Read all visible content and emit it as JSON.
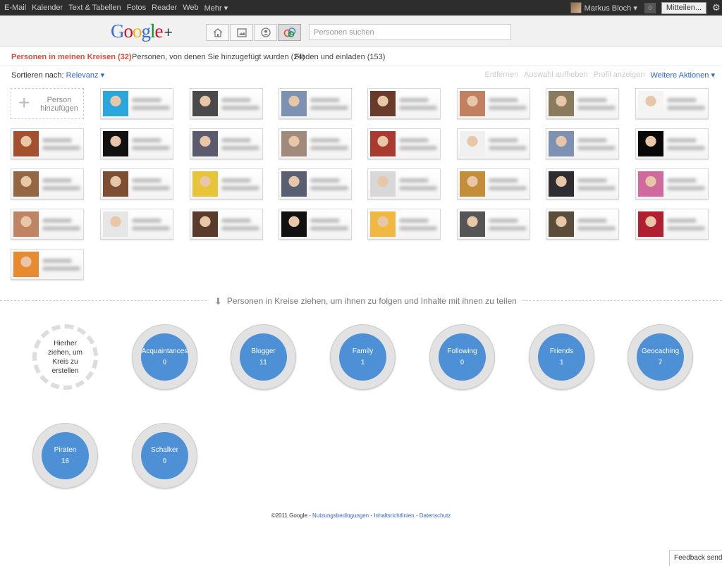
{
  "topbar": {
    "nav": [
      {
        "label": "E-Mail",
        "name": "nav-email"
      },
      {
        "label": "Kalender",
        "name": "nav-calendar"
      },
      {
        "label": "Text & Tabellen",
        "name": "nav-docs"
      },
      {
        "label": "Fotos",
        "name": "nav-photos"
      },
      {
        "label": "Reader",
        "name": "nav-reader"
      },
      {
        "label": "Web",
        "name": "nav-web"
      },
      {
        "label": "Mehr ▾",
        "name": "nav-more"
      }
    ],
    "user_name": "Markus Bloch ▾",
    "notif_count": "0",
    "share_label": "Mitteilen...",
    "gear_icon": "⚙"
  },
  "header": {
    "logo_letters": [
      {
        "ch": "G",
        "color": "#3369e8"
      },
      {
        "ch": "o",
        "color": "#d50f25"
      },
      {
        "ch": "o",
        "color": "#eeb211"
      },
      {
        "ch": "g",
        "color": "#3369e8"
      },
      {
        "ch": "l",
        "color": "#009925"
      },
      {
        "ch": "e",
        "color": "#d50f25"
      }
    ],
    "logo_plus": "+",
    "nav_icons": [
      "home-icon",
      "photos-icon",
      "profile-icon",
      "circles-icon"
    ],
    "search_placeholder": "Personen suchen"
  },
  "tabs": [
    {
      "label": "Personen in meinen Kreisen (32)",
      "name": "tab-in-my-circles",
      "active": true
    },
    {
      "label": "Personen, von denen Sie hinzugefügt wurden (24)",
      "name": "tab-added-me",
      "active": false
    },
    {
      "label": "Finden und einladen (153)",
      "name": "tab-find-invite",
      "active": false
    }
  ],
  "sort": {
    "label": "Sortieren nach:",
    "value": "Relevanz ▾"
  },
  "actions": {
    "remove": "Entfernen",
    "clear_selection": "Auswahl aufheben",
    "show_profile": "Profil anzeigen",
    "more_actions": "Weitere Aktionen ▾"
  },
  "add_person": {
    "plus": "+",
    "label": "Person hinzufügen"
  },
  "people_avatars": [
    "#2aa8dd",
    "#4a4a4a",
    "#7d91b3",
    "#6a3b2a",
    "#c28060",
    "#8a7a5e",
    "#f4f4f4",
    "#a4502e",
    "#111111",
    "#5c5a6e",
    "#a28a7a",
    "#a83a30",
    "#f0f0f0",
    "#7d91b3",
    "#080808",
    "#946642",
    "#7e4e32",
    "#e8c438",
    "#595f71",
    "#d8d8d8",
    "#c48d3a",
    "#2f2c32",
    "#d06a9e",
    "#c08464",
    "#e6e6e6",
    "#5a3a2a",
    "#111111",
    "#f0b840",
    "#555555",
    "#5a4e3a",
    "#b02030",
    "#e88a30"
  ],
  "drop_label": "Personen in Kreise ziehen, um ihnen zu folgen und Inhalte mit ihnen zu teilen",
  "drop_arrow": "⬇",
  "new_circle_label": "Hierher ziehen, um Kreis zu erstellen",
  "circles": [
    {
      "name": "Acquaintances",
      "count": "0"
    },
    {
      "name": "Blogger",
      "count": "11"
    },
    {
      "name": "Family",
      "count": "1"
    },
    {
      "name": "Following",
      "count": "0"
    },
    {
      "name": "Friends",
      "count": "1"
    },
    {
      "name": "Geocaching",
      "count": "7"
    },
    {
      "name": "Piraten",
      "count": "16"
    },
    {
      "name": "Schalker",
      "count": "0"
    }
  ],
  "footer": {
    "copyright": "©2011 Google - ",
    "terms": "Nutzungsbedingungen",
    "sep": " - ",
    "content_policy": "Inhaltsrichtlinien",
    "privacy": "Datenschutz"
  },
  "feedback": "Feedback senden"
}
